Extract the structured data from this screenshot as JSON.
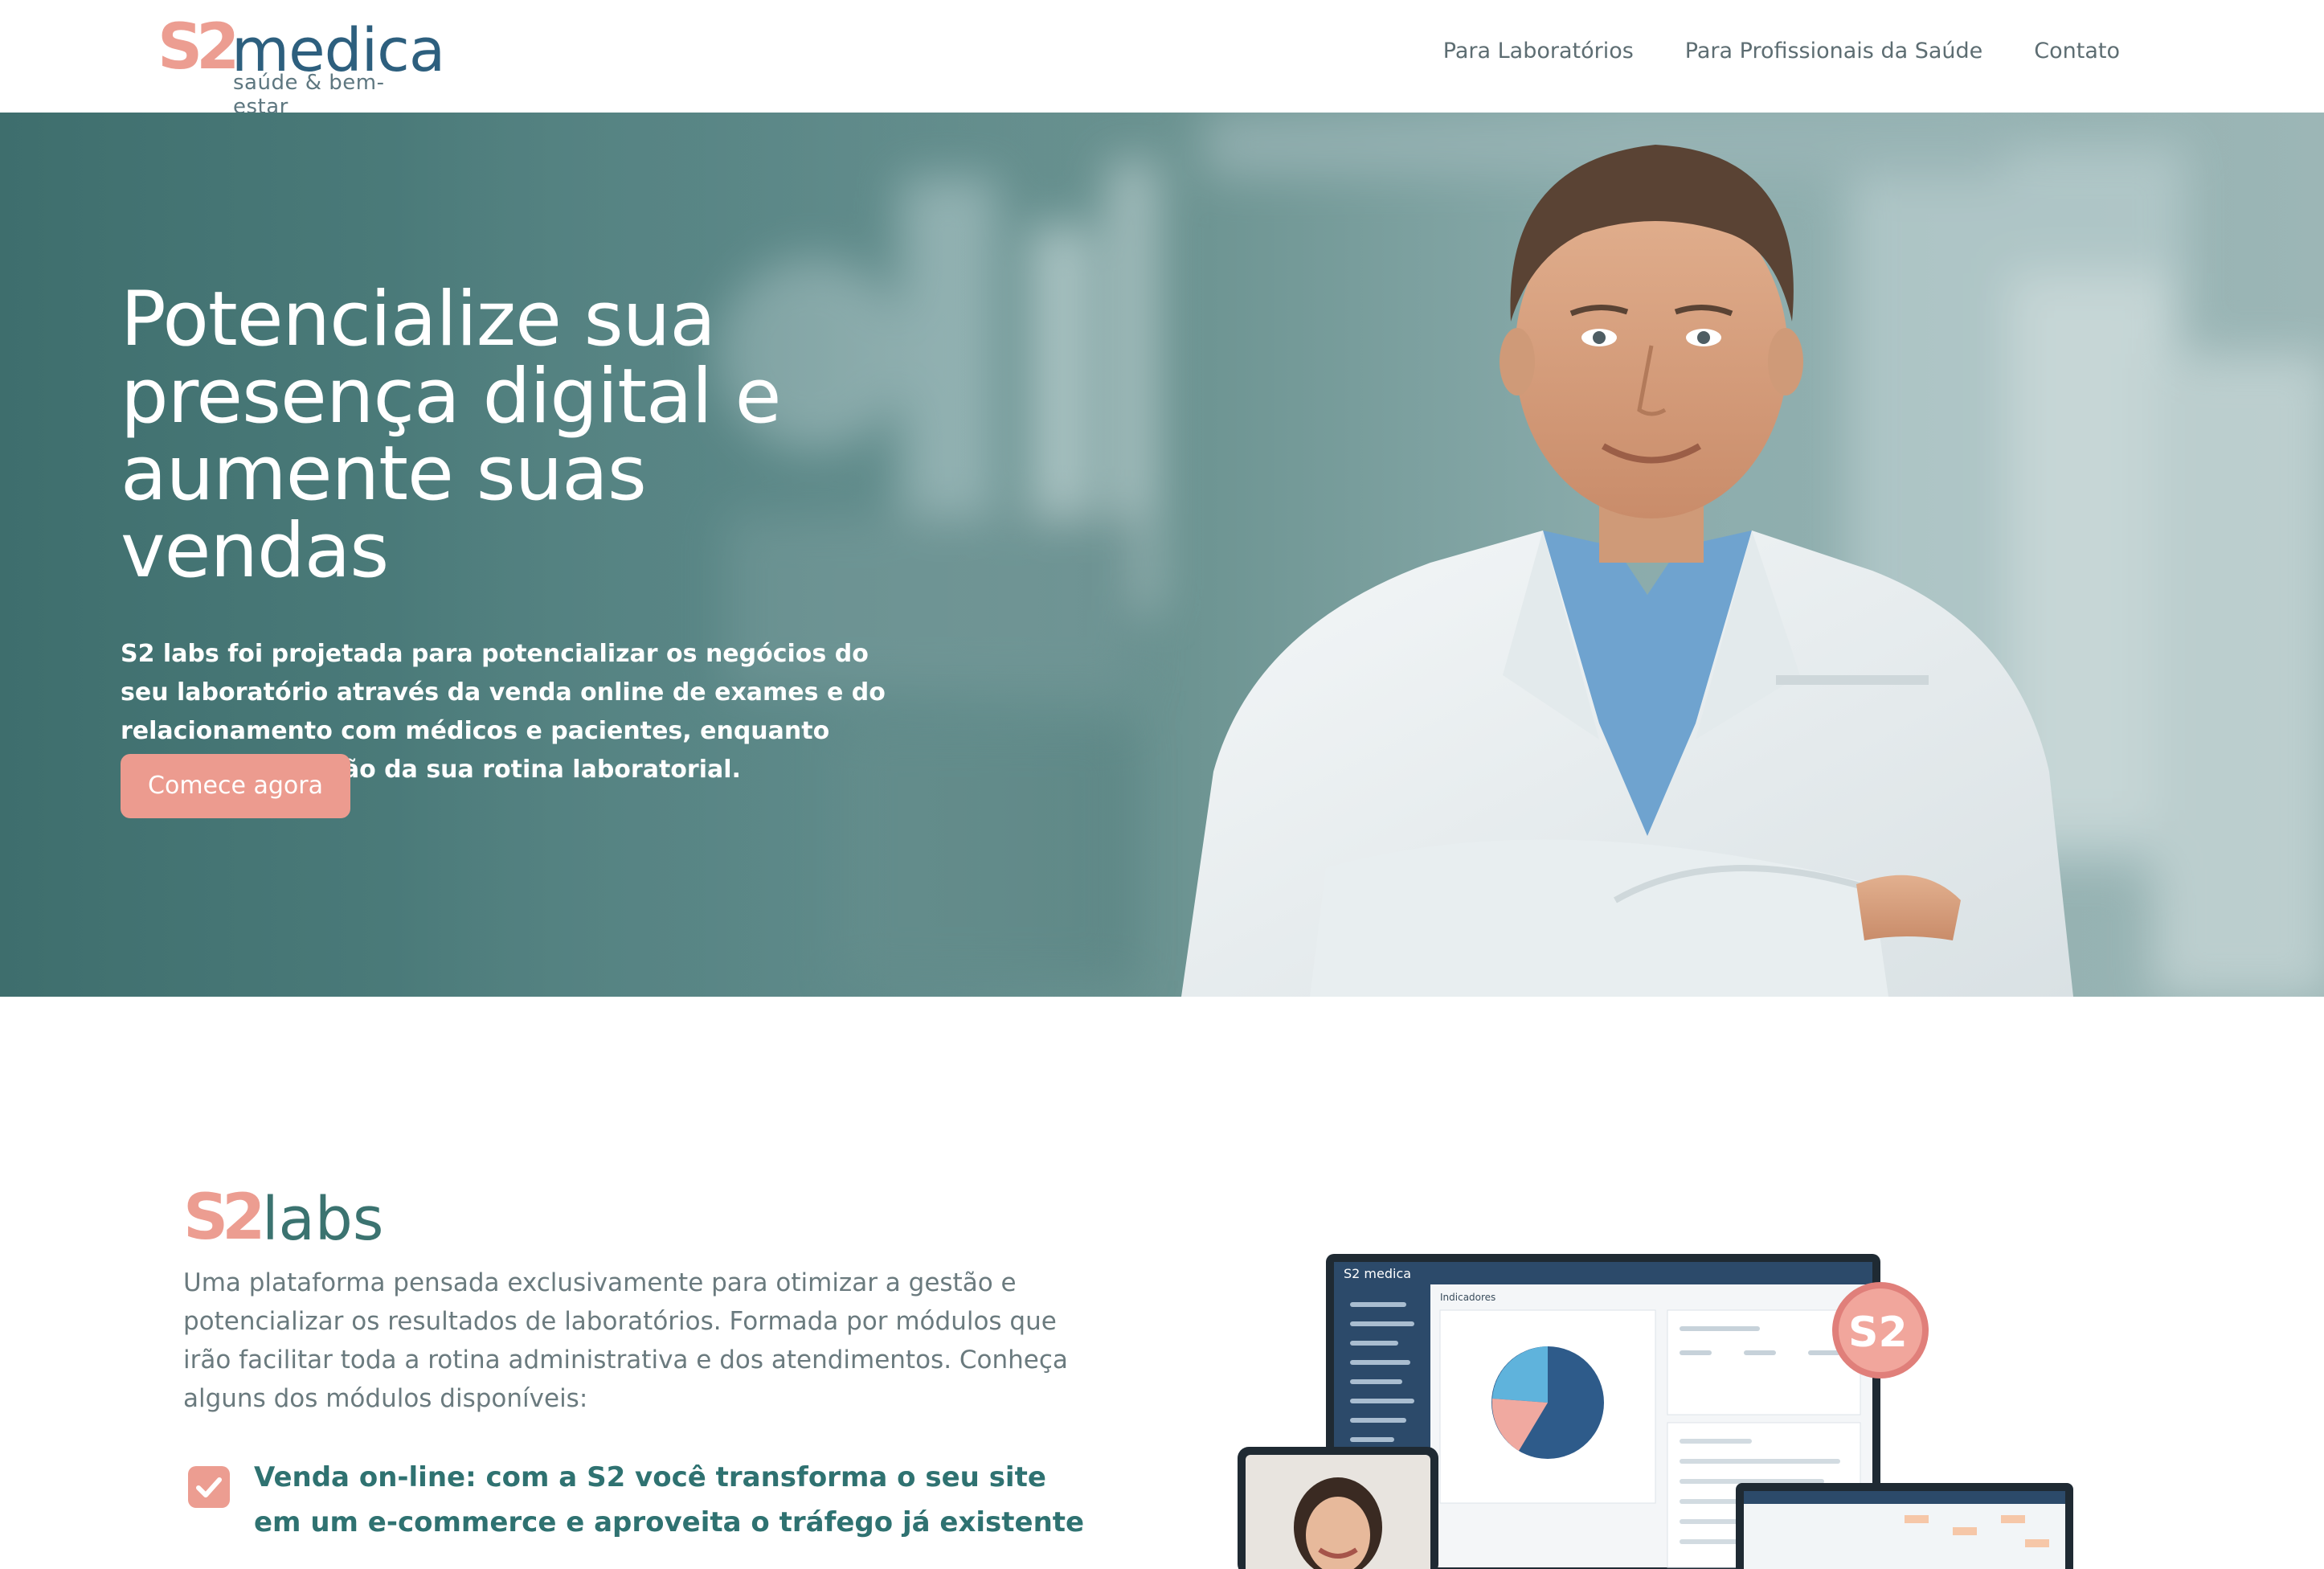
{
  "header": {
    "logo": {
      "mark": "S2",
      "word": "medica",
      "tagline": "saúde & bem-estar"
    },
    "nav": [
      {
        "label": "Para Laboratórios"
      },
      {
        "label": "Para Profissionais da Saúde"
      },
      {
        "label": "Contato"
      }
    ]
  },
  "hero": {
    "title_lines": [
      "Potencialize sua",
      "presença digital e",
      "aumente suas vendas"
    ],
    "desc_bold": "S2 labs",
    "desc_rest": " foi projetada para potencializar os negócios do seu laboratório através da venda online de exames e do relacionamento com médicos e pacientes, enquanto simplifica a gestão da sua rotina laboratorial.",
    "cta": "Comece agora"
  },
  "labs": {
    "logo": {
      "mark": "S2",
      "word": "labs"
    },
    "description": "Uma plataforma pensada exclusivamente para otimizar a gestão e potencializar os resultados de laboratórios. Formada por módulos que irão facilitar toda a rotina administrativa e dos atendimentos. Conheça alguns dos módulos disponíveis:",
    "features": [
      {
        "text": "Venda on-line: com a S2 você transforma o seu site em um e-commerce e aproveita o tráfego já existente"
      }
    ]
  },
  "mockup": {
    "laptop_brand": "S2 medica",
    "dashboard_title": "Indicadores",
    "badge": "S2"
  },
  "colors": {
    "brand_coral": "#ec9d91",
    "brand_navy": "#2d5f7e",
    "brand_teal": "#3b7370"
  }
}
